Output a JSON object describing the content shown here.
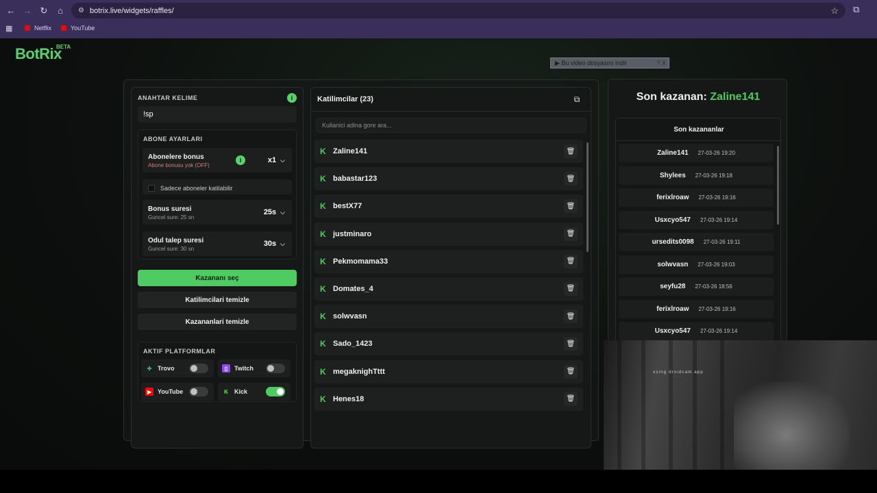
{
  "browser": {
    "url": "botrix.live/widgets/raffles/",
    "bookmarks": [
      {
        "label": "Netflix",
        "color": "#e50914"
      },
      {
        "label": "YouTube",
        "color": "#ff0000"
      }
    ]
  },
  "app": {
    "logo": "BotRix",
    "logo_badge": "BETA",
    "video_download": "▶ Bu video dosyasını indir",
    "video_download_btns": "?  X"
  },
  "settings": {
    "keyword_title": "ANAHTAR KELIME",
    "keyword_value": "!sp",
    "subs_title": "ABONE AYARLARI",
    "sub_bonus_title": "Abonelere bonus",
    "sub_bonus_sub": "Abone bonusu yok (OFF)",
    "sub_bonus_value": "x1",
    "subs_only_label": "Sadece aboneler katilabilir",
    "bonus_time_title": "Bonus suresi",
    "bonus_time_sub": "Guncel sure: 25 sn",
    "bonus_time_value": "25s",
    "claim_time_title": "Odul talep suresi",
    "claim_time_sub": "Guncel sure: 30 sn",
    "claim_time_value": "30s",
    "pick_winner": "Kazananı seç",
    "clear_participants": "Katilimcilari temizle",
    "clear_winners": "Kazananlari temizle",
    "platforms_title": "AKTIF PLATFORMLAR",
    "platforms": [
      {
        "name": "Trovo",
        "on": false,
        "color": "#1fbf6b"
      },
      {
        "name": "Twitch",
        "on": false,
        "color": "#9146ff"
      },
      {
        "name": "YouTube",
        "on": false,
        "color": "#ff0000"
      },
      {
        "name": "Kick",
        "on": true,
        "color": "#53fc18"
      }
    ]
  },
  "participants": {
    "title": "Katilimcilar (23)",
    "search_placeholder": "Kullanici adina gore ara...",
    "list": [
      "Zaline141",
      "babastar123",
      "bestX77",
      "justminaro",
      "Pekmomama33",
      "Domates_4",
      "solwvasn",
      "Sado_1423",
      "megaknighTttt",
      "Henes18"
    ]
  },
  "winners": {
    "last_label": "Son kazanan:",
    "last_name": "Zaline141",
    "list_title": "Son kazananlar",
    "list": [
      {
        "name": "Zaline141",
        "time": "27-03-26 19:20"
      },
      {
        "name": "Shylees",
        "time": "27-03-26 19:18"
      },
      {
        "name": "ferixlroaw",
        "time": "27-03-26 19:16"
      },
      {
        "name": "Usxcyo547",
        "time": "27-03-26 19:14"
      },
      {
        "name": "ursedits0098",
        "time": "27-03-26 19:11"
      },
      {
        "name": "solwvasn",
        "time": "27-03-26 19:03"
      },
      {
        "name": "seyfu28",
        "time": "27-03-26 18:56"
      },
      {
        "name": "ferixlroaw",
        "time": "27-03-26 19:16"
      },
      {
        "name": "Usxcyo547",
        "time": "27-03-26 19:14"
      }
    ]
  },
  "webcam": {
    "overlay_text": "using droidcam.app"
  }
}
